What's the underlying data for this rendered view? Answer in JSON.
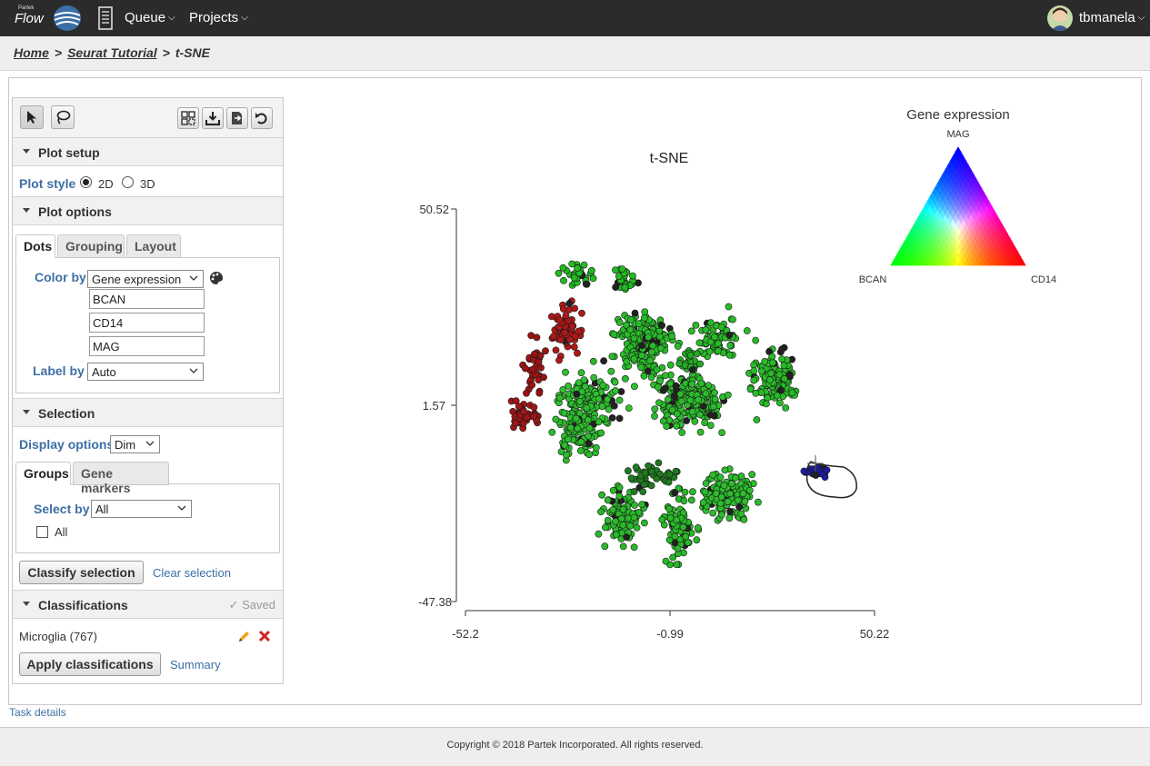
{
  "nav": {
    "logo_small": "Partek",
    "logo_text": "Flow",
    "queue": "Queue",
    "projects": "Projects",
    "user": "tbmanela"
  },
  "breadcrumb": {
    "home": "Home",
    "project": "Seurat Tutorial",
    "current": "t-SNE",
    "separator": ">"
  },
  "panel": {
    "plot_setup": {
      "header": "Plot setup",
      "plot_style_label": "Plot style",
      "options": [
        "2D",
        "3D"
      ],
      "selected": "2D"
    },
    "plot_options": {
      "header": "Plot options",
      "tabs": [
        "Dots",
        "Grouping",
        "Layout"
      ],
      "active_tab": "Dots",
      "color_by_label": "Color by",
      "color_by_value": "Gene expression",
      "genes": [
        "BCAN",
        "CD14",
        "MAG"
      ],
      "label_by_label": "Label by",
      "label_by_value": "Auto"
    },
    "selection": {
      "header": "Selection",
      "display_options_label": "Display options",
      "display_options_value": "Dim",
      "tabs": [
        "Groups",
        "Gene markers"
      ],
      "active_tab": "Groups",
      "select_by_label": "Select by",
      "select_by_value": "All",
      "all_checkbox_label": "All",
      "classify_button": "Classify selection",
      "clear_link": "Clear selection"
    },
    "classifications": {
      "header": "Classifications",
      "saved": "✓ Saved",
      "items": [
        {
          "label": "Microglia (767)"
        }
      ],
      "apply_button": "Apply classifications",
      "summary_link": "Summary"
    }
  },
  "task_details": "Task details",
  "footer": "Copyright © 2018 Partek Incorporated. All rights reserved.",
  "legend": {
    "title": "Gene expression",
    "top": "MAG",
    "left": "BCAN",
    "right": "CD14"
  },
  "chart_data": {
    "type": "scatter",
    "title": "t-SNE",
    "xlabel": "",
    "ylabel": "",
    "xlim": [
      -52.2,
      50.22
    ],
    "ylim": [
      -47.38,
      50.52
    ],
    "x_ticks": [
      "-52.2",
      "-0.99",
      "50.22"
    ],
    "y_ticks": [
      "50.52",
      "1.57",
      "-47.38"
    ],
    "grid": false,
    "clusters": [
      {
        "cx": -24,
        "cy": 34,
        "sx": 1.8,
        "sy": 1.4,
        "n": 30,
        "color": "#22bb22"
      },
      {
        "cx": -12,
        "cy": 33,
        "sx": 1.5,
        "sy": 1.5,
        "n": 25,
        "color": "#22bb22"
      },
      {
        "cx": -8,
        "cy": 17,
        "sx": 3.6,
        "sy": 3.6,
        "n": 200,
        "color": "#28bb28"
      },
      {
        "cx": 11,
        "cy": 18,
        "sx": 2.6,
        "sy": 2.2,
        "n": 80,
        "color": "#28bb28"
      },
      {
        "cx": 4,
        "cy": 12,
        "sx": 1.1,
        "sy": 1.3,
        "n": 25,
        "color": "#22aa22"
      },
      {
        "cx": 4,
        "cy": 2.5,
        "sx": 4.0,
        "sy": 3.2,
        "n": 230,
        "color": "#2cbb2c"
      },
      {
        "cx": 25,
        "cy": 8,
        "sx": 3.0,
        "sy": 3.5,
        "n": 130,
        "color": "#28bb28"
      },
      {
        "cx": -21,
        "cy": 3,
        "sx": 3.6,
        "sy": 3.0,
        "n": 110,
        "color": "#2ec02e"
      },
      {
        "cx": -24,
        "cy": -4,
        "sx": 2.6,
        "sy": 3.5,
        "n": 120,
        "color": "#2cbc2c"
      },
      {
        "cx": 13,
        "cy": -21,
        "sx": 3.0,
        "sy": 2.7,
        "n": 150,
        "color": "#2cbc2c"
      },
      {
        "cx": -13,
        "cy": -26,
        "sx": 2.5,
        "sy": 3.5,
        "n": 95,
        "color": "#2ab82a"
      },
      {
        "cx": 1,
        "cy": -28,
        "sx": 2.2,
        "sy": 3.8,
        "n": 100,
        "color": "#28b828"
      },
      {
        "cx": -6,
        "cy": -16,
        "sx": 3.0,
        "sy": 1.6,
        "n": 45,
        "color": "#1f7a1f"
      },
      {
        "cx": -27,
        "cy": 20,
        "sx": 1.8,
        "sy": 2.8,
        "n": 70,
        "color": "#b01818"
      },
      {
        "cx": -35,
        "cy": 10,
        "sx": 1.5,
        "sy": 3.8,
        "n": 35,
        "color": "#9a1414"
      },
      {
        "cx": -38,
        "cy": -1,
        "sx": 1.8,
        "sy": 1.4,
        "n": 45,
        "color": "#a01616"
      },
      {
        "cx": 36,
        "cy": -15,
        "sx": 1.6,
        "sy": 0.8,
        "n": 30,
        "color": "#1a1aa0"
      }
    ]
  }
}
